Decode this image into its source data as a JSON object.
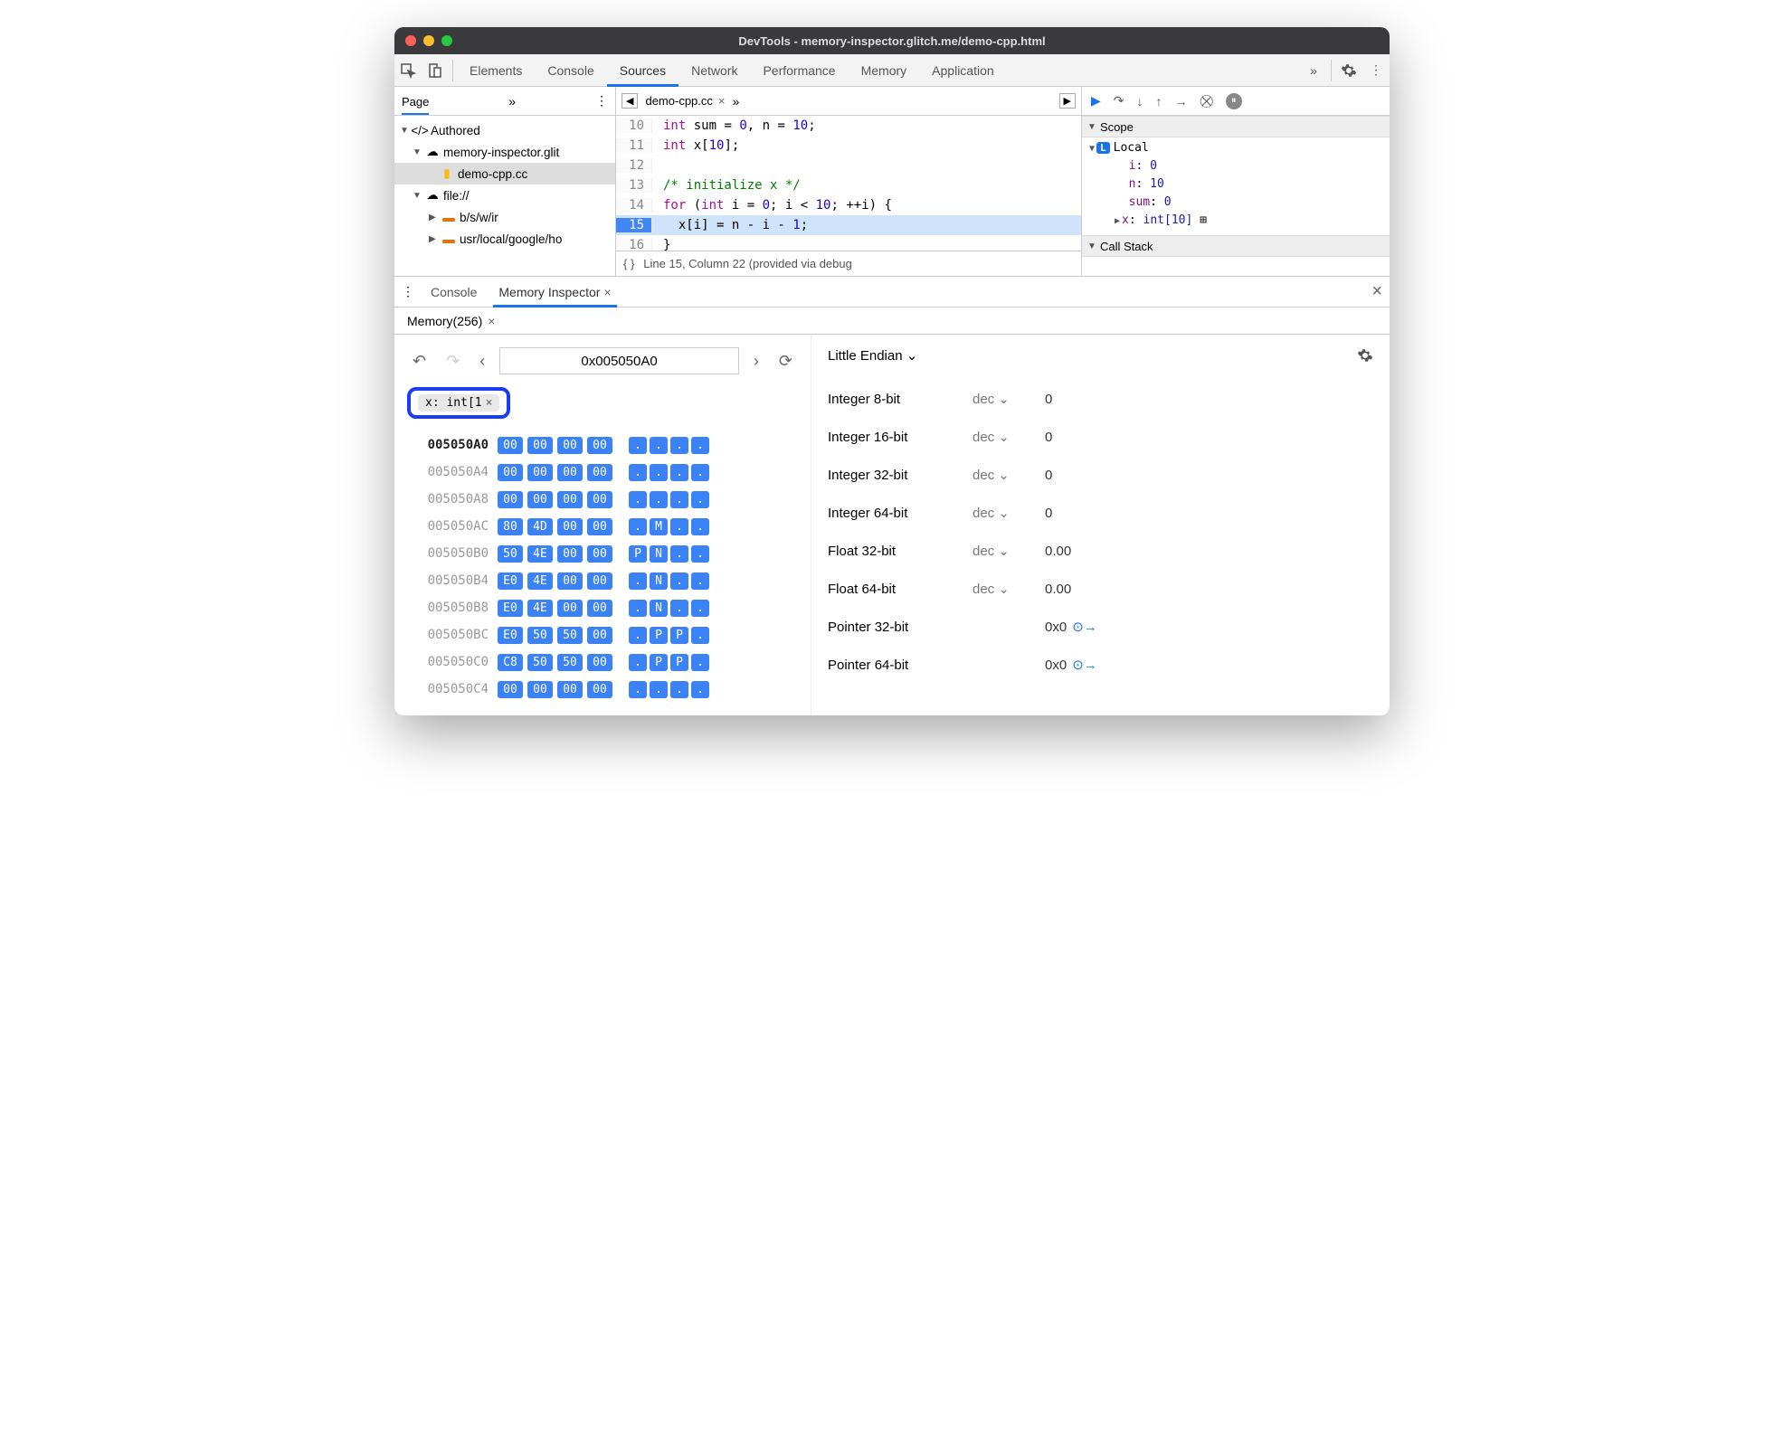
{
  "window": {
    "title": "DevTools - memory-inspector.glitch.me/demo-cpp.html"
  },
  "topTabs": [
    "Elements",
    "Console",
    "Sources",
    "Network",
    "Performance",
    "Memory",
    "Application"
  ],
  "topTabActive": "Sources",
  "sidebar": {
    "headLabel": "Page",
    "tree": {
      "authored": "Authored",
      "domain": "memory-inspector.glit",
      "file": "demo-cpp.cc",
      "fileScheme": "file://",
      "folder1": "b/s/w/ir",
      "folder2": "usr/local/google/ho"
    }
  },
  "editor": {
    "fileTab": "demo-cpp.cc",
    "lines": [
      {
        "n": 10,
        "html": "<span class='kw'>int</span> sum = <span class='num'>0</span>, n = <span class='num'>10</span>;"
      },
      {
        "n": 11,
        "html": "<span class='kw'>int</span> x[<span class='num'>10</span>];"
      },
      {
        "n": 12,
        "html": ""
      },
      {
        "n": 13,
        "html": "<span class='com'>/* initialize x */</span>"
      },
      {
        "n": 14,
        "html": "<span class='kw'>for</span> (<span class='kw'>int</span> i = <span class='num'>0</span>; i &lt; <span class='num'>10</span>; ++i) {"
      },
      {
        "n": 15,
        "html": "  x[i] = n - i - <span class='num'>1</span>;",
        "hl": true
      },
      {
        "n": 16,
        "html": "}"
      }
    ],
    "status": "Line 15, Column 22 (provided via debug"
  },
  "scope": {
    "title": "Scope",
    "localLabel": "Local",
    "vars": [
      {
        "name": "i",
        "val": "0"
      },
      {
        "name": "n",
        "val": "10"
      },
      {
        "name": "sum",
        "val": "0"
      },
      {
        "name": "x",
        "val": "int[10]",
        "expand": true
      }
    ],
    "callStack": "Call Stack"
  },
  "bottomTabs": {
    "console": "Console",
    "mi": "Memory Inspector"
  },
  "memoryTab": "Memory(256)",
  "mi": {
    "address": "0x005050A0",
    "tag": "x: int[1",
    "endian": "Little Endian",
    "rows": [
      {
        "addr": "005050A0",
        "hex": [
          "00",
          "00",
          "00",
          "00"
        ],
        "asc": [
          ".",
          ".",
          ".",
          "."
        ],
        "bold": true
      },
      {
        "addr": "005050A4",
        "hex": [
          "00",
          "00",
          "00",
          "00"
        ],
        "asc": [
          ".",
          ".",
          ".",
          "."
        ]
      },
      {
        "addr": "005050A8",
        "hex": [
          "00",
          "00",
          "00",
          "00"
        ],
        "asc": [
          ".",
          ".",
          ".",
          "."
        ]
      },
      {
        "addr": "005050AC",
        "hex": [
          "80",
          "4D",
          "00",
          "00"
        ],
        "asc": [
          ".",
          "M",
          ".",
          "."
        ]
      },
      {
        "addr": "005050B0",
        "hex": [
          "50",
          "4E",
          "00",
          "00"
        ],
        "asc": [
          "P",
          "N",
          ".",
          "."
        ]
      },
      {
        "addr": "005050B4",
        "hex": [
          "E0",
          "4E",
          "00",
          "00"
        ],
        "asc": [
          ".",
          "N",
          ".",
          "."
        ]
      },
      {
        "addr": "005050B8",
        "hex": [
          "E0",
          "4E",
          "00",
          "00"
        ],
        "asc": [
          ".",
          "N",
          ".",
          "."
        ]
      },
      {
        "addr": "005050BC",
        "hex": [
          "E0",
          "50",
          "50",
          "00"
        ],
        "asc": [
          ".",
          "P",
          "P",
          "."
        ]
      },
      {
        "addr": "005050C0",
        "hex": [
          "C8",
          "50",
          "50",
          "00"
        ],
        "asc": [
          ".",
          "P",
          "P",
          "."
        ]
      },
      {
        "addr": "005050C4",
        "hex": [
          "00",
          "00",
          "00",
          "00"
        ],
        "asc": [
          ".",
          ".",
          ".",
          "."
        ]
      }
    ],
    "values": [
      {
        "label": "Integer 8-bit",
        "fmt": "dec",
        "val": "0"
      },
      {
        "label": "Integer 16-bit",
        "fmt": "dec",
        "val": "0"
      },
      {
        "label": "Integer 32-bit",
        "fmt": "dec",
        "val": "0"
      },
      {
        "label": "Integer 64-bit",
        "fmt": "dec",
        "val": "0"
      },
      {
        "label": "Float 32-bit",
        "fmt": "dec",
        "val": "0.00"
      },
      {
        "label": "Float 64-bit",
        "fmt": "dec",
        "val": "0.00"
      },
      {
        "label": "Pointer 32-bit",
        "fmt": "",
        "val": "0x0",
        "jump": true
      },
      {
        "label": "Pointer 64-bit",
        "fmt": "",
        "val": "0x0",
        "jump": true
      }
    ]
  }
}
